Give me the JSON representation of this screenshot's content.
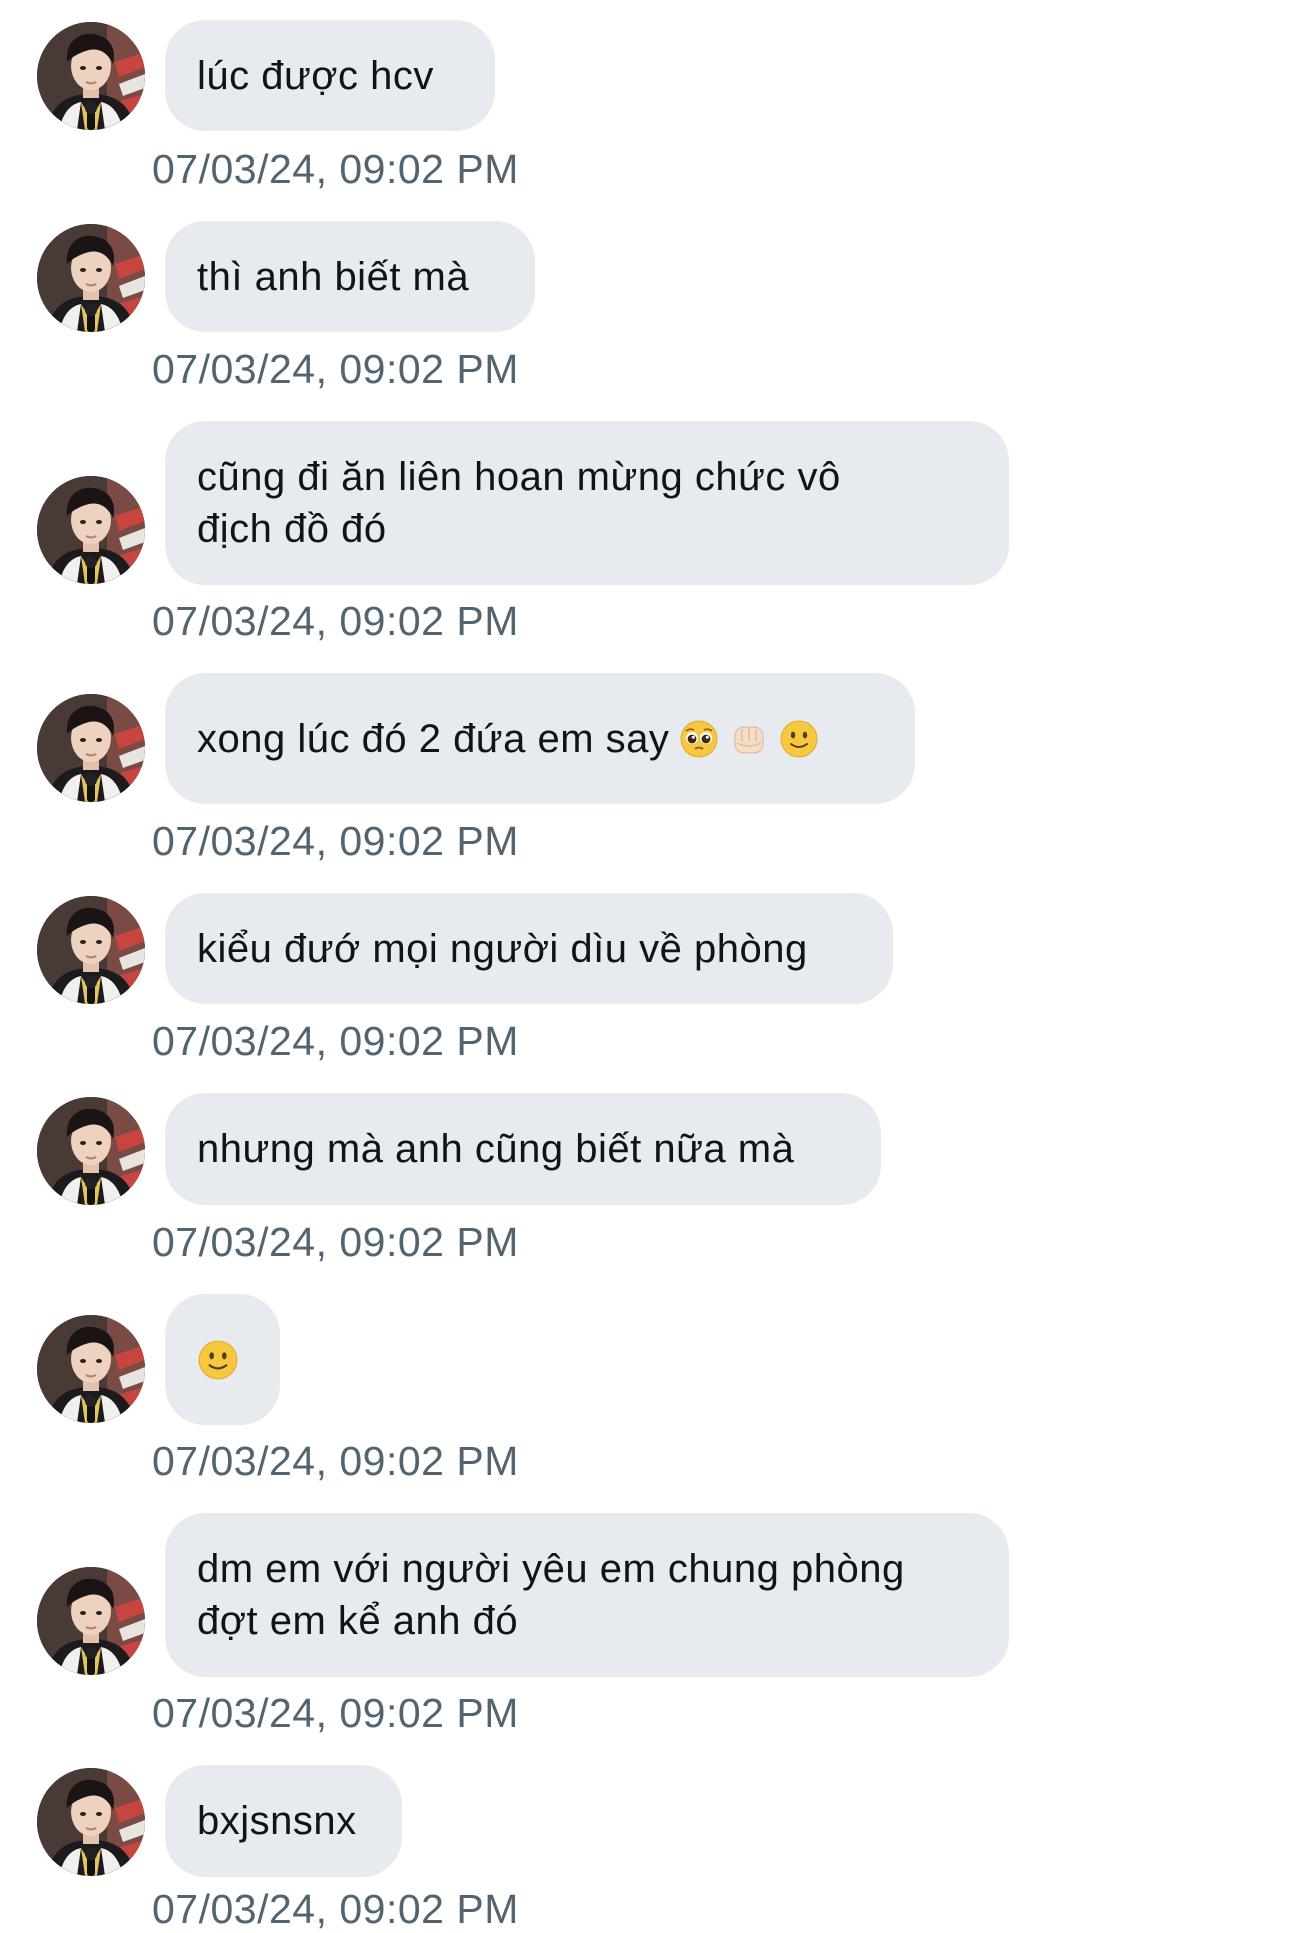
{
  "colors": {
    "bubble_bg": "#e7ebef",
    "message_text": "#0f1419",
    "timestamp_text": "#536471",
    "background": "#ffffff"
  },
  "messages": [
    {
      "text": "lúc được hcv",
      "timestamp": "07/03/24, 09:02 PM"
    },
    {
      "text": "thì anh biết mà",
      "timestamp": "07/03/24, 09:02 PM"
    },
    {
      "text": "cũng đi ăn liên hoan mừng chức vô\nđịch đồ đó",
      "timestamp": "07/03/24, 09:02 PM"
    },
    {
      "text": "xong lúc đó 2 đứa em say",
      "emojis": [
        "pleading-face",
        "fist-bump-light-skin",
        "slightly-smiling-face"
      ],
      "timestamp": "07/03/24, 09:02 PM"
    },
    {
      "text": "kiểu đướ mọi người dìu về phòng",
      "timestamp": "07/03/24, 09:02 PM"
    },
    {
      "text": "nhưng mà anh cũng biết nữa mà",
      "timestamp": "07/03/24, 09:02 PM"
    },
    {
      "text": "",
      "emojis": [
        "slightly-smiling-face"
      ],
      "timestamp": "07/03/24, 09:02 PM"
    },
    {
      "text": "dm em với người yêu em chung phòng\nđợt em kể anh đó",
      "timestamp": "07/03/24, 09:02 PM"
    },
    {
      "text": "bxjsnsnx",
      "timestamp": "07/03/24, 09:02 PM"
    }
  ]
}
